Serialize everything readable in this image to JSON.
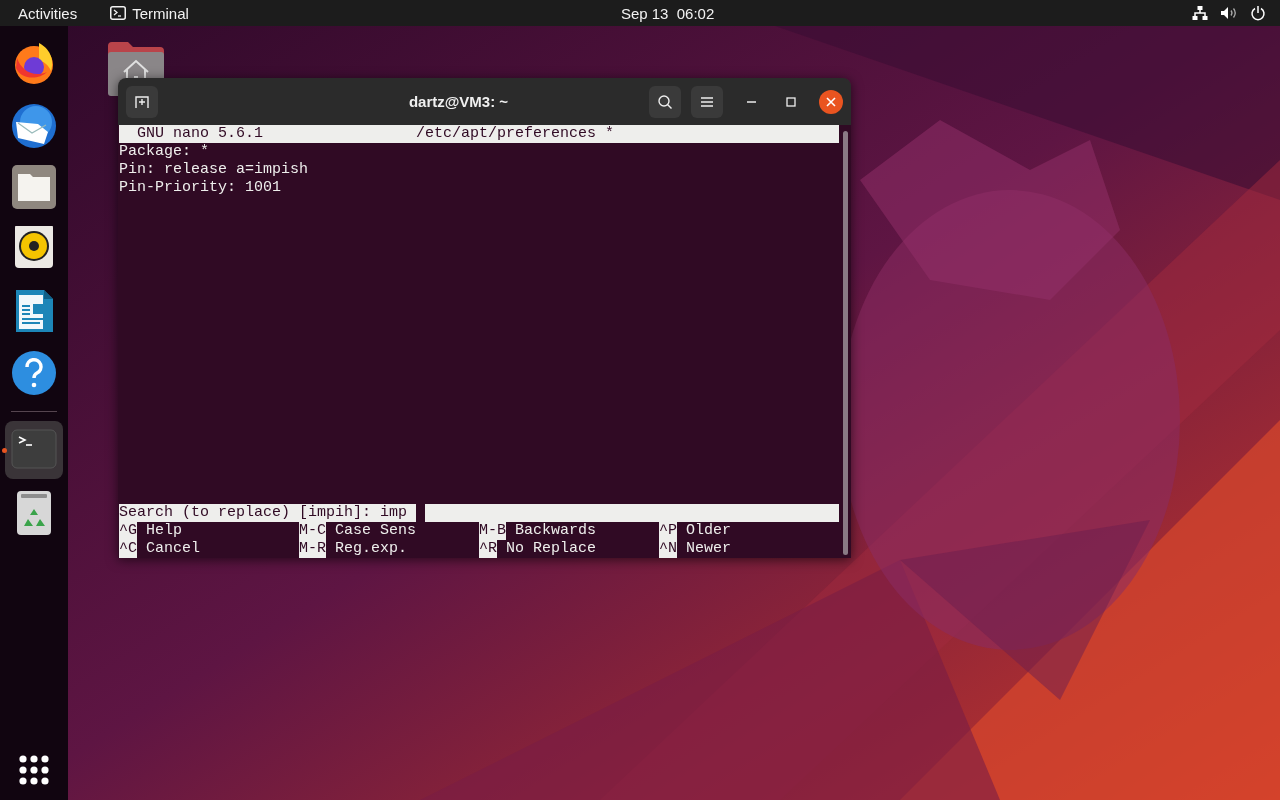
{
  "top_bar": {
    "activities": "Activities",
    "app": {
      "label": "Terminal"
    },
    "clock": "Sep 13  06:02"
  },
  "dock": {
    "items": [
      {
        "kind": "browser",
        "selected": false,
        "running": false
      },
      {
        "kind": "mail",
        "selected": false,
        "running": false
      },
      {
        "kind": "files",
        "selected": false,
        "running": false
      },
      {
        "kind": "music",
        "selected": false,
        "running": false
      },
      {
        "kind": "writer",
        "selected": false,
        "running": false
      },
      {
        "kind": "help",
        "selected": false,
        "running": false
      },
      {
        "kind": "separator"
      },
      {
        "kind": "terminal",
        "selected": true,
        "running": true
      },
      {
        "kind": "trash",
        "selected": false,
        "running": false
      }
    ]
  },
  "window": {
    "title": "dartz@VM3: ~",
    "nano": {
      "title": "GNU nano 5.6.1",
      "filename": "/etc/apt/preferences *",
      "lines": [
        "Package: *",
        "Pin: release a=impish",
        "Pin-Priority: 1001"
      ],
      "prompt": "Search (to replace) [impih]:",
      "value": "imp",
      "shortcuts": [
        {
          "key": "^G",
          "label": "Help"
        },
        {
          "key": "M-C",
          "label": "Case Sens"
        },
        {
          "key": "M-B",
          "label": "Backwards"
        },
        {
          "key": "^P",
          "label": "Older"
        },
        {
          "key": "^C",
          "label": "Cancel"
        },
        {
          "key": "M-R",
          "label": "Reg.exp."
        },
        {
          "key": "^R",
          "label": "No Replace"
        },
        {
          "key": "^N",
          "label": "Newer"
        }
      ]
    }
  }
}
